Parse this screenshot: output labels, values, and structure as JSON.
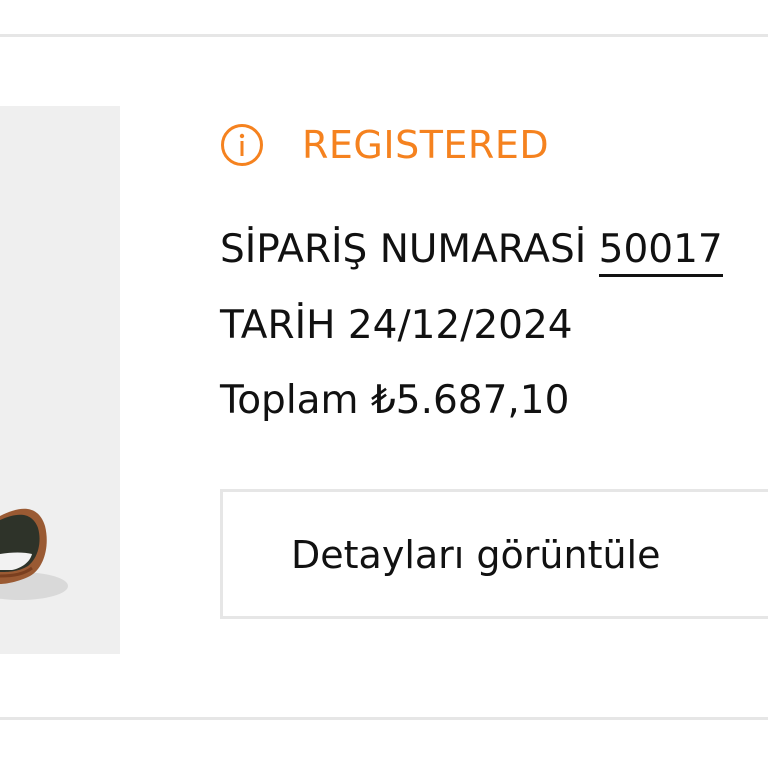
{
  "order": {
    "status": "REGISTERED",
    "status_icon": "info-circle-icon",
    "status_color": "#f5821f",
    "order_number_label": "SİPARİŞ NUMARASİ",
    "order_number": "50017",
    "date_label": "TARİH",
    "date": "24/12/2024",
    "total_label": "Toplam",
    "total": "₺5.687,10",
    "details_button_label": "Detayları görüntüle"
  },
  "product_image": {
    "description_icon": "shoe-icon"
  }
}
